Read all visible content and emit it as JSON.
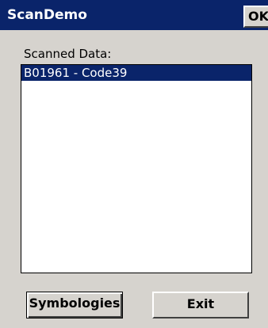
{
  "window": {
    "title": "ScanDemo",
    "ok_label": "OK"
  },
  "main": {
    "list_label": "Scanned Data:",
    "list_items": [
      {
        "text": "B01961 - Code39",
        "selected": true
      }
    ]
  },
  "buttons": {
    "symbologies_label": "Symbologies",
    "exit_label": "Exit"
  },
  "colors": {
    "titlebar": "#0a246a",
    "selection": "#0a246a",
    "face": "#d6d3ce"
  }
}
